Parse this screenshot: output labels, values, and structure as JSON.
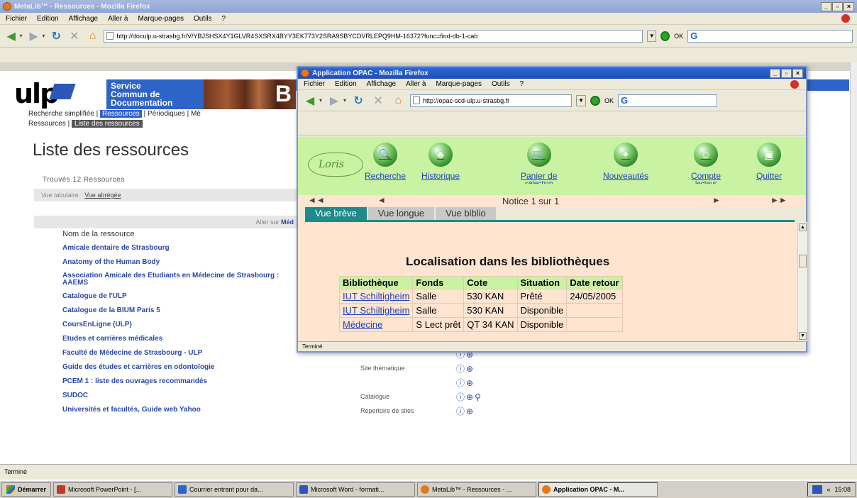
{
  "main_window": {
    "title": "MetaLib™ - Ressources - Mozilla Firefox",
    "menu": [
      "Fichier",
      "Edition",
      "Affichage",
      "Aller à",
      "Marque-pages",
      "Outils",
      "?"
    ],
    "url": "http://doculp.u-strasbg.fr/V/YBJSHSX4Y1GLVR4SXSRX4BYY3EK773Y2SRA9SBYCDVRLEPQ9HM-16372?func=find-db-1-cab",
    "ok_label": "OK",
    "search_icon": "G",
    "status": "Terminé"
  },
  "ulp_page": {
    "logo_text": "ulp",
    "scd_title": [
      "Service",
      "Commun de",
      "Documentation"
    ],
    "banner_letter": "B",
    "nav_items": [
      "Recherche simplifiée",
      "Ressources",
      "Périodiques",
      "Mé"
    ],
    "nav_active": "Ressources",
    "subnav_label": "Ressources",
    "subnav_active": "Liste des ressources",
    "title": "Liste des ressources",
    "found": "Trouvés 12 Ressources",
    "view_tabular": "Vue tabulaire",
    "view_short": "Vue abrégée",
    "aller_sur": "Aller sur",
    "aller_target": "Méd",
    "column_header": "Nom de la ressource",
    "resources": [
      {
        "name": "Amicale dentaire de Strasbourg",
        "kind": "",
        "icons": ""
      },
      {
        "name": "Anatomy of the Human Body",
        "kind": "",
        "icons": ""
      },
      {
        "name": "Association Amicale des Etudiants en Médecine de Strasbourg : AAEMS",
        "kind": "",
        "icons": ""
      },
      {
        "name": "Catalogue de l'ULP",
        "kind": "",
        "icons": ""
      },
      {
        "name": "Catalogue de la BIUM Paris 5",
        "kind": "",
        "icons": ""
      },
      {
        "name": "CoursEnLigne (ULP)",
        "kind": "",
        "icons": ""
      },
      {
        "name": "Etudes et carrières médicales",
        "kind": "",
        "icons": ""
      },
      {
        "name": "Faculté de Médecine de Strasbourg - ULP",
        "kind": "",
        "icons": "ⓘ⊕"
      },
      {
        "name": "Guide des études et carrières en odontologie",
        "kind": "Site thématique",
        "icons": "ⓘ⊕"
      },
      {
        "name": "PCEM 1 : liste des ouvrages recommandés",
        "kind": "",
        "icons": "ⓘ⊕"
      },
      {
        "name": "SUDOC",
        "kind": "Catalogue",
        "icons": "ⓘ⊕"
      },
      {
        "name": "Universités et facultés, Guide web Yahoo",
        "kind": "Repertoire de sites",
        "icons": "ⓘ⊕"
      }
    ]
  },
  "popup": {
    "title": "Application OPAC - Mozilla Firefox",
    "menu": [
      "Fichier",
      "Edition",
      "Affichage",
      "Aller à",
      "Marque-pages",
      "Outils",
      "?"
    ],
    "url": "http://opac-scd-ulp.u-strasbg.fr",
    "ok_label": "OK",
    "search_icon": "G",
    "logo": "Loris",
    "buttons": [
      {
        "label": "Recherche",
        "sub": "",
        "icon": "🔍"
      },
      {
        "label": "Historique",
        "sub": "",
        "icon": "♣"
      },
      {
        "label": "Panier de",
        "sub": "sélection",
        "icon": "🛒"
      },
      {
        "label": "Nouveautés",
        "sub": "",
        "icon": "✦"
      },
      {
        "label": "Compte",
        "sub": "lecteur",
        "icon": "☺"
      },
      {
        "label": "Quitter",
        "sub": "",
        "icon": "▣"
      }
    ],
    "notice_text": "Notice 1 sur 1",
    "tabs": [
      "Vue brève",
      "Vue longue",
      "Vue biblio"
    ],
    "active_tab": "Vue brève",
    "loc_title": "Localisation dans les bibliothèques",
    "table_headers": [
      "Bibliothèque",
      "Fonds",
      "Cote",
      "Situation",
      "Date retour"
    ],
    "table_rows": [
      [
        "IUT Schiltigheim",
        "Salle",
        "530 KAN",
        "Prêté",
        "24/05/2005"
      ],
      [
        "IUT Schiltigheim",
        "Salle",
        "530 KAN",
        "Disponible",
        ""
      ],
      [
        "Médecine",
        "S Lect prêt",
        "QT 34 KAN",
        "Disponible",
        ""
      ]
    ],
    "status": "Terminé"
  },
  "taskbar": {
    "start": "Démarrer",
    "tasks": [
      {
        "label": "Microsoft PowerPoint - [...",
        "color": "#c0392b"
      },
      {
        "label": "Courrier entrant pour da...",
        "color": "#2e63c8"
      },
      {
        "label": "Microsoft Word - formati...",
        "color": "#2b58b8"
      },
      {
        "label": "MetaLib™ - Ressources - ...",
        "color": "#e07a1e"
      },
      {
        "label": "Application OPAC - M...",
        "color": "#e07a1e"
      }
    ],
    "active_task": 4,
    "tray_lang": "«",
    "clock": "15:08"
  }
}
